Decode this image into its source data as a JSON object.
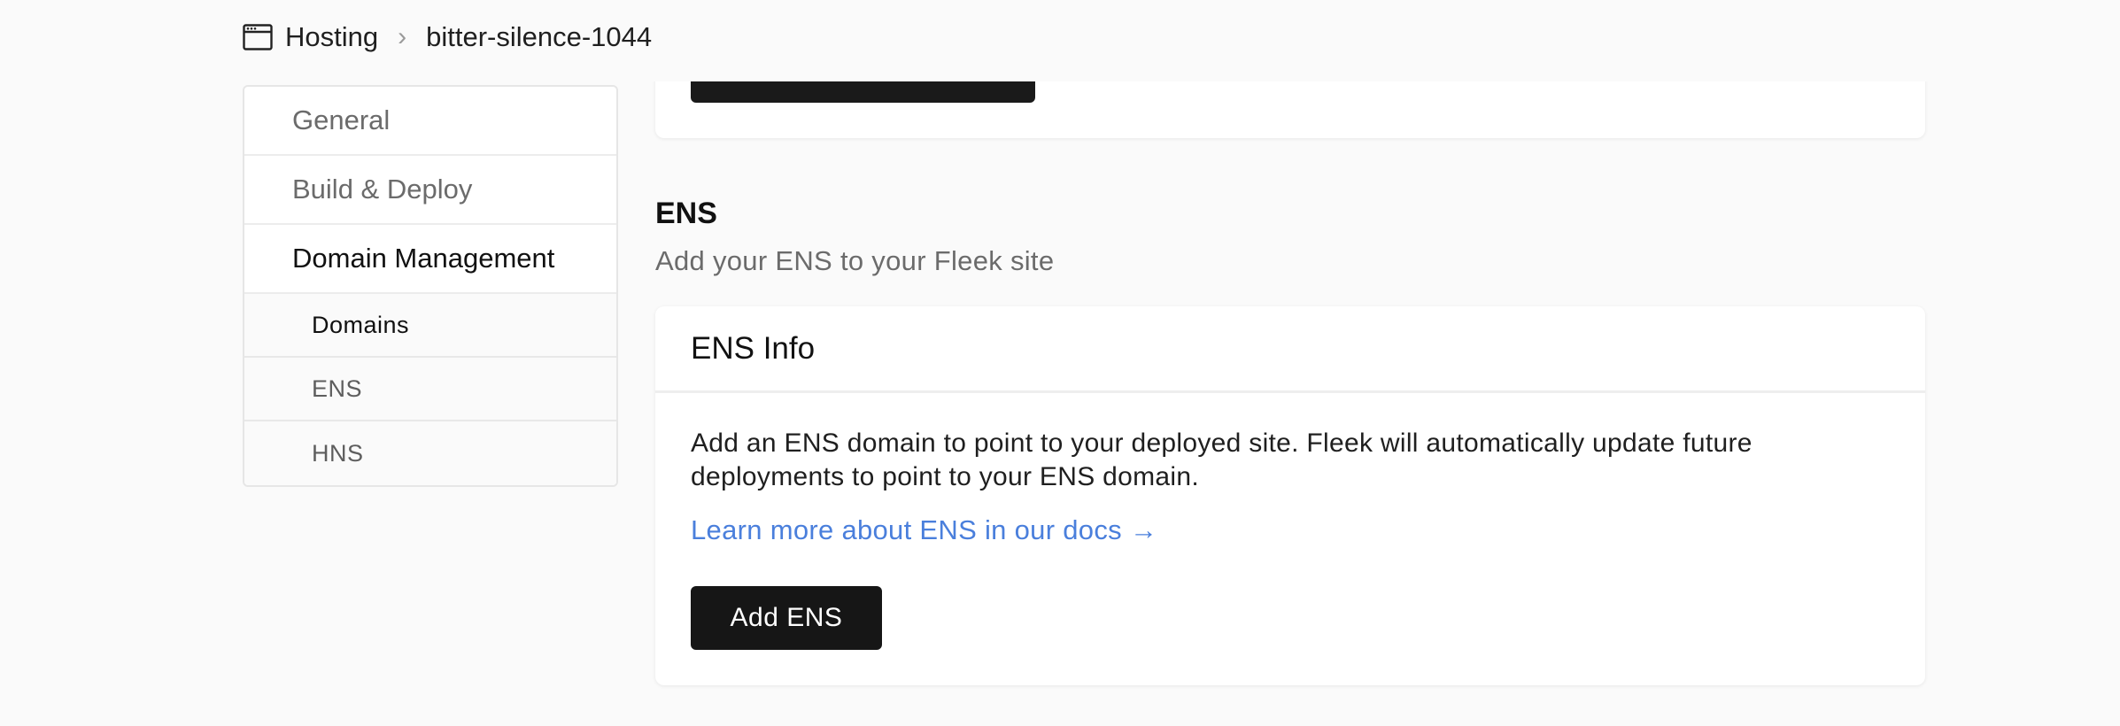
{
  "breadcrumb": {
    "root": "Hosting",
    "separator": "›",
    "current": "bitter-silence-1044"
  },
  "sidebar": {
    "items": [
      {
        "label": "General"
      },
      {
        "label": "Build & Deploy"
      },
      {
        "label": "Domain Management"
      }
    ],
    "subitems": [
      {
        "label": "Domains"
      },
      {
        "label": "ENS"
      },
      {
        "label": "HNS"
      }
    ]
  },
  "section": {
    "title": "ENS",
    "subtitle": "Add your ENS to your Fleek site"
  },
  "ens_card": {
    "title": "ENS Info",
    "description": "Add an ENS domain to point to your deployed site. Fleek will automatically update future deployments to point to your ENS domain.",
    "docs_link": "Learn more about ENS in our docs →",
    "add_button": "Add ENS"
  },
  "colors": {
    "link": "#4a7fdc",
    "button": "#161616",
    "background": "#fafafa"
  }
}
